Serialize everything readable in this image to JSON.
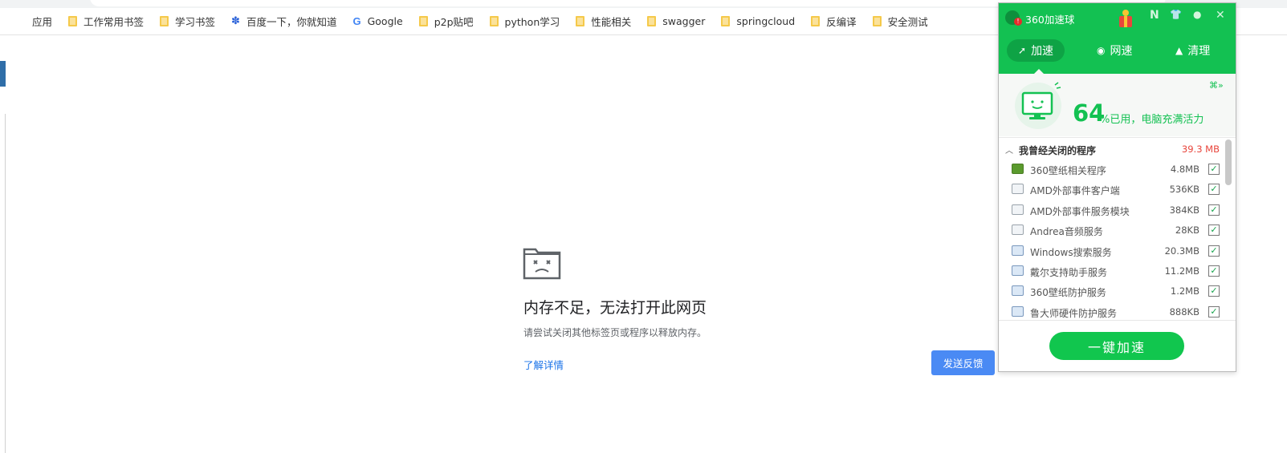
{
  "bookmarks": [
    {
      "label": "应用",
      "icon": "apps-grid-icon"
    },
    {
      "label": "工作常用书签",
      "icon": "folder-icon"
    },
    {
      "label": "学习书签",
      "icon": "folder-icon"
    },
    {
      "label": "百度一下，你就知道",
      "icon": "baidu-paw-icon"
    },
    {
      "label": "Google",
      "icon": "google-g-icon"
    },
    {
      "label": "p2p贴吧",
      "icon": "folder-icon"
    },
    {
      "label": "python学习",
      "icon": "folder-icon"
    },
    {
      "label": "性能相关",
      "icon": "folder-icon"
    },
    {
      "label": "swagger",
      "icon": "folder-icon"
    },
    {
      "label": "springcloud",
      "icon": "folder-icon"
    },
    {
      "label": "反编译",
      "icon": "folder-icon"
    },
    {
      "label": "安全测试",
      "icon": "folder-icon"
    }
  ],
  "error_page": {
    "title": "内存不足，无法打开此网页",
    "description": "请尝试关闭其他标签页或程序以释放内存。",
    "learn_more": "了解详情",
    "feedback_button": "发送反馈"
  },
  "panel": {
    "title": "360加速球",
    "badge": "!",
    "tools": [
      "N",
      "👕",
      "●",
      "✕"
    ],
    "tabs": [
      {
        "label": "加速",
        "icon": "rocket-icon",
        "active": true
      },
      {
        "label": "网速",
        "icon": "speed-icon",
        "active": false
      },
      {
        "label": "清理",
        "icon": "broom-icon",
        "active": false
      }
    ],
    "usage_percent": "64",
    "usage_text": "%已用，电脑充满活力",
    "list_title": "我曾经关闭的程序",
    "list_total": "39.3 MB",
    "programs": [
      {
        "name": "360壁纸相关程序",
        "size": "4.8MB",
        "icon": "wallpaper-app-icon",
        "checked": true
      },
      {
        "name": "AMD外部事件客户端",
        "size": "536KB",
        "icon": "window-app-icon",
        "checked": true
      },
      {
        "name": "AMD外部事件服务模块",
        "size": "384KB",
        "icon": "window-app-icon",
        "checked": true
      },
      {
        "name": "Andrea音频服务",
        "size": "28KB",
        "icon": "window-app-icon",
        "checked": true
      },
      {
        "name": "Windows搜索服务",
        "size": "20.3MB",
        "icon": "service-icon",
        "checked": true
      },
      {
        "name": "戴尔支持助手服务",
        "size": "11.2MB",
        "icon": "service-icon",
        "checked": true
      },
      {
        "name": "360壁纸防护服务",
        "size": "1.2MB",
        "icon": "service-icon",
        "checked": true
      },
      {
        "name": "鲁大师硬件防护服务",
        "size": "888KB",
        "icon": "service-icon",
        "checked": true
      }
    ],
    "boost_button": "一键加速",
    "colors": {
      "brand_green": "#13c152",
      "alert_red": "#e8453c",
      "link_blue": "#1a73e8",
      "button_blue": "#4a8af4"
    }
  }
}
